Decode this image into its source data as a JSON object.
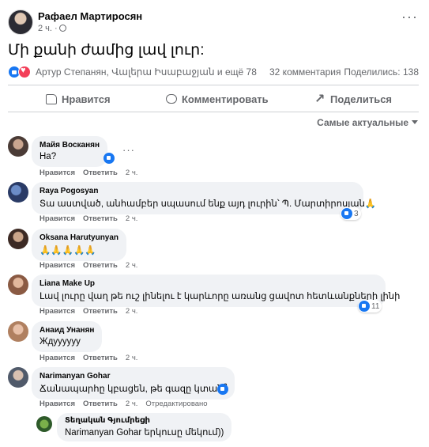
{
  "post": {
    "author": "Рафаел Мартиросян",
    "time": "2 ч. ·",
    "text": "Մի քանի ժամից լավ լուր:",
    "reactors": "Артур Степанян, Վալերա Իսաբաջյան и ещё 78",
    "comment_count": "32 комментария",
    "share_count": "Поделились: 138"
  },
  "actions": {
    "like": "Нравится",
    "comment": "Комментировать",
    "share": "Поделиться"
  },
  "sort_label": "Самые актуальные",
  "comment_labels": {
    "like": "Нравится",
    "reply": "Ответить",
    "edited": "Отредактировано"
  },
  "comments": [
    {
      "author": "Майя Восканян",
      "text": "Ha?",
      "time": "2 ч.",
      "reaction_count": ""
    },
    {
      "author": "Raya Pogosyan",
      "text": "Տա աստված, անհամբեր սպասում ենք այդ լուրին՝ Պ. Մարտիրոսյան🙏",
      "time": "2 ч.",
      "reaction_count": "3"
    },
    {
      "author": "Oksana Harutyunyan",
      "text": "🙏🙏🙏🙏🙏",
      "time": "2 ч.",
      "reaction_count": ""
    },
    {
      "author": "Liana Make Up",
      "text": "Լավ լուրը վաղ թե ուշ լինելու է կարևորը առանց ցավոտ հետևանքների լինի",
      "time": "2 ч.",
      "reaction_count": "11"
    },
    {
      "author": "Анаид Унанян",
      "text": "Ждуууууу",
      "time": "2 ч.",
      "reaction_count": ""
    },
    {
      "author": "Narimanyan Gohar",
      "text": "Ճանապարհը կբացեն, թե գազը կտան՞",
      "time": "2 ч.",
      "reaction_count": ""
    }
  ],
  "reply": {
    "author": "Տեղական Գյումրեցի",
    "text": "Narimanyan Gohar երկուսը մեկում))"
  }
}
